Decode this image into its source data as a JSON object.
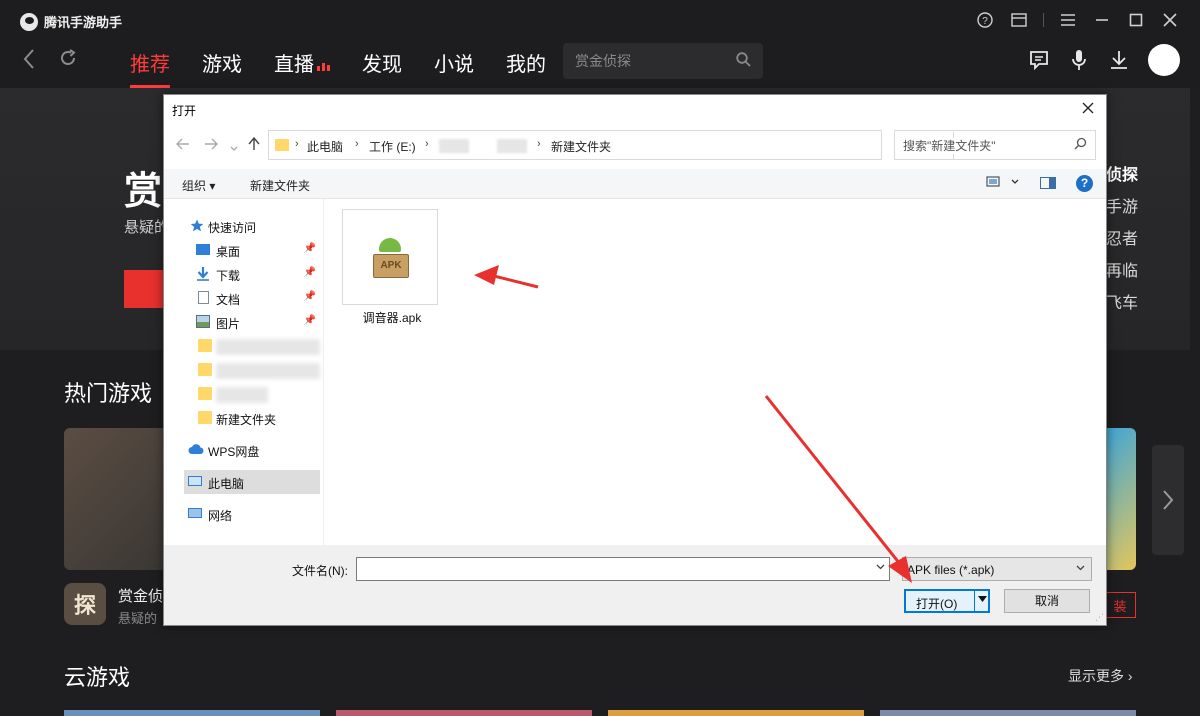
{
  "app": {
    "name": "腾讯手游助手",
    "nav_tabs": [
      {
        "label": "推荐",
        "active": true
      },
      {
        "label": "游戏"
      },
      {
        "label": "直播"
      },
      {
        "label": "发现"
      },
      {
        "label": "小说"
      },
      {
        "label": "我的"
      }
    ],
    "search_placeholder": "赏金侦探",
    "banner": {
      "title": "赏",
      "subtitle": "悬疑的"
    },
    "side_list": [
      "侦探",
      "手游",
      "忍者",
      "再临",
      "飞车"
    ],
    "section_hot": "热门游戏",
    "hot_game": {
      "icon_text": "探",
      "name": "赏金侦",
      "desc": "悬疑的",
      "install_label": "装"
    },
    "section_cloud": "云游戏",
    "show_more": "显示更多 ›"
  },
  "dialog": {
    "title": "打开",
    "path": [
      "此电脑",
      "工作 (E:)",
      "新建文件夹"
    ],
    "search_placeholder": "搜索\"新建文件夹\"",
    "commands": {
      "organize": "组织 ▾",
      "new_folder": "新建文件夹"
    },
    "nav": {
      "quick_access": "快速访问",
      "desktop": "桌面",
      "downloads": "下载",
      "documents": "文档",
      "pictures": "图片",
      "new_folder": "新建文件夹",
      "wps": "WPS网盘",
      "this_pc": "此电脑",
      "network": "网络"
    },
    "files": [
      {
        "name": "调音器.apk",
        "icon_label": "APK"
      }
    ],
    "filename_label": "文件名(N):",
    "filename_value": "",
    "file_type": "APK files (*.apk)",
    "open_label": "打开(O)",
    "cancel_label": "取消"
  },
  "colors": {
    "accent": "#ff3b3b",
    "dialog_focus": "#0078d7",
    "annotation": "#e8302d"
  }
}
